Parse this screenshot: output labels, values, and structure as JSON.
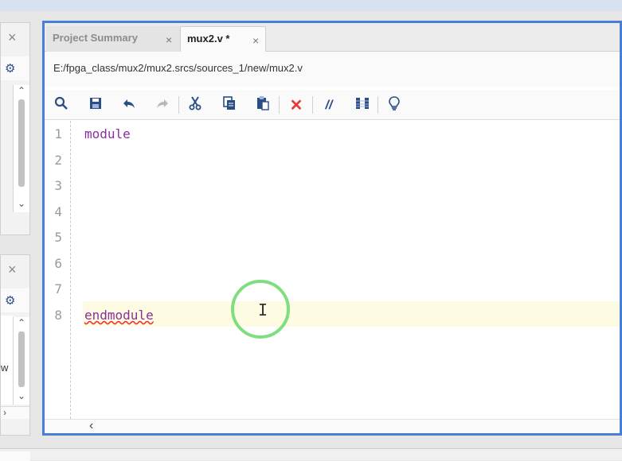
{
  "editor": {
    "tabs": [
      {
        "label": "Project Summary",
        "close": "×"
      },
      {
        "label": "mux2.v *",
        "close": "×"
      }
    ],
    "file_path": "E:/fpga_class/mux2/mux2.srcs/sources_1/new/mux2.v",
    "line_numbers": [
      "1",
      "2",
      "3",
      "4",
      "5",
      "6",
      "7",
      "8"
    ],
    "code_lines": {
      "line1": "module",
      "line8": "endmodule"
    }
  },
  "left_panels": {
    "close_symbol": "×",
    "partial_text": "w",
    "scroll_up": "⌃",
    "scroll_down": "⌄"
  },
  "icons": {
    "search": "search-icon",
    "save": "save-icon",
    "undo": "undo-icon",
    "redo": "redo-icon",
    "cut": "cut-icon",
    "copy": "copy-icon",
    "paste": "paste-icon",
    "delete": "delete-icon",
    "comment": "comment-icon",
    "block": "block-icon",
    "bulb": "lightbulb-icon"
  },
  "colors": {
    "accent": "#4a7ed6",
    "keyword": "#8a2f9e",
    "current_line": "#fdfbe1",
    "delete_red": "#e53935"
  }
}
